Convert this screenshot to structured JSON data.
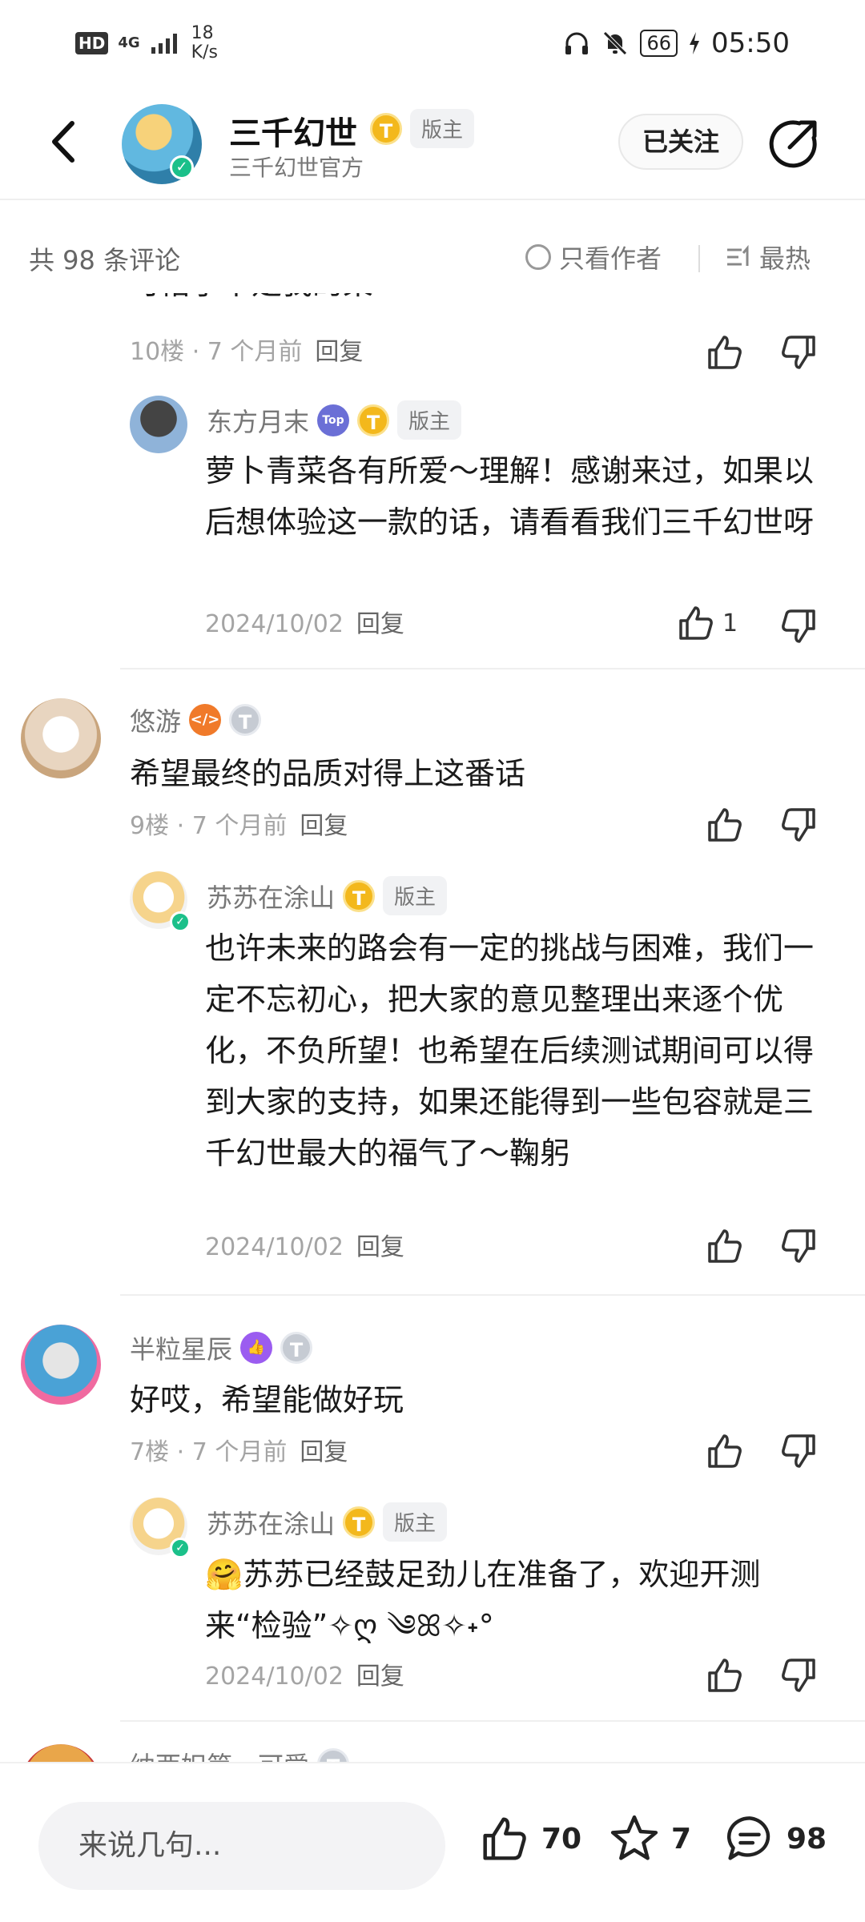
{
  "status_bar": {
    "hd": "HD",
    "network": "4G",
    "speed_value": "18",
    "speed_unit": "K/s",
    "battery": "66",
    "time": "05:50"
  },
  "header": {
    "title": "三千幻世",
    "level_badge": "T",
    "role_badge": "版主",
    "subtitle": "三千幻世官方",
    "follow_label": "已关注"
  },
  "filter": {
    "count_label": "共 98 条评论",
    "author_only_label": "只看作者",
    "sort_label": "最热"
  },
  "comments": [
    {
      "partial_text": "可惜了不是我的菜",
      "meta": "10楼 · 7 个月前",
      "reply_label": "回复",
      "reply": {
        "user": "东方月末",
        "role_badge": "版主",
        "top_badge": "Top",
        "text": "萝卜青菜各有所爱～理解！感谢来过，如果以后想体验这一款的话，请看看我们三千幻世呀",
        "date": "2024/10/02",
        "reply_label": "回复",
        "likes": "1"
      }
    },
    {
      "user": "悠游",
      "text": "希望最终的品质对得上这番话",
      "meta": "9楼 · 7 个月前",
      "reply_label": "回复",
      "reply": {
        "user": "苏苏在涂山",
        "role_badge": "版主",
        "text": "也许未来的路会有一定的挑战与困难，我们一定不忘初心，把大家的意见整理出来逐个优化，不负所望！也希望在后续测试期间可以得到大家的支持，如果还能得到一些包容就是三千幻世最大的福气了～鞠躬",
        "date": "2024/10/02",
        "reply_label": "回复"
      }
    },
    {
      "user": "半粒星辰",
      "text": "好哎，希望能做好玩",
      "meta": "7楼 · 7 个月前",
      "reply_label": "回复",
      "reply": {
        "user": "苏苏在涂山",
        "role_badge": "版主",
        "text": "🤗苏苏已经鼓足劲儿在准备了，欢迎开测来“检验”✧ღ ༄ꕤ✧˖°",
        "date": "2024/10/02",
        "reply_label": "回复"
      }
    },
    {
      "user": "纳西妲第一可爱"
    }
  ],
  "bottom_bar": {
    "input_placeholder": "来说几句...",
    "likes": "70",
    "favorites": "7",
    "comments": "98"
  },
  "colors": {
    "accent_gold": "#f3b81c",
    "verify_green": "#1bc08a",
    "meta_gray": "#a4a4a4"
  }
}
